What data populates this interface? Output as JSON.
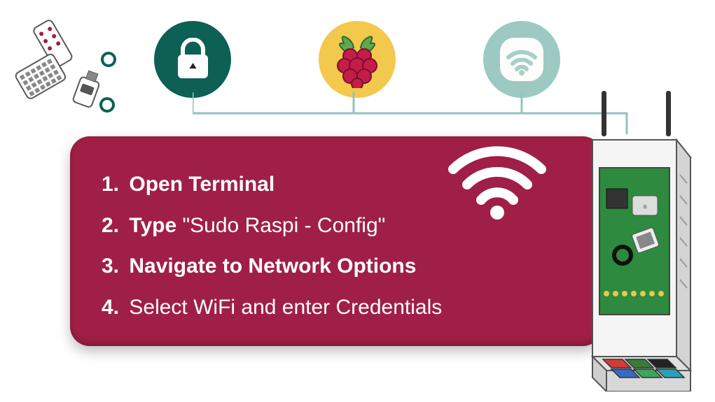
{
  "steps": {
    "s1_num": "1.",
    "s1_bold": "Open Terminal",
    "s2_num": "2.",
    "s2_bold": "Type",
    "s2_quoted": "\"Sudo Raspi - Config\"",
    "s3_num": "3.",
    "s3_bold": "Navigate to Network Options",
    "s4_num": "4.",
    "s4_text": "Select WiFi and enter Credentials"
  },
  "icons": {
    "lock": "lock-icon",
    "raspberry": "raspberry-icon",
    "wifi": "wifi-icon",
    "usb": "usb-devices",
    "device": "raspberry-pi-device"
  },
  "colors": {
    "card": "#a01f46",
    "lock_bg": "#0d6054",
    "raspberry_bg": "#f2c94c",
    "wifi_bg": "#9dc9c3",
    "connector": "#8fc4bc"
  }
}
